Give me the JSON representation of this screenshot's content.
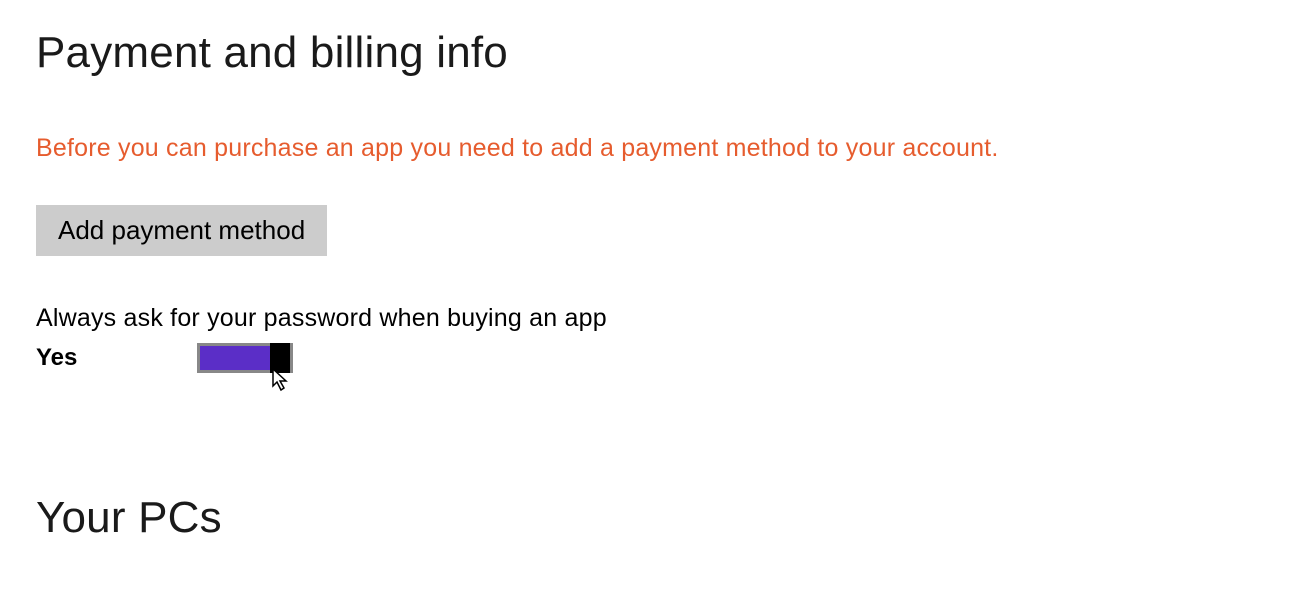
{
  "page": {
    "title": "Payment and billing info"
  },
  "warning": {
    "text": "Before you can purchase an app you need to add a payment method to your account."
  },
  "buttons": {
    "add_payment": "Add payment method"
  },
  "settings": {
    "password_prompt": {
      "label": "Always ask for your password when buying an app",
      "value": "Yes",
      "state": "on"
    }
  },
  "sections": {
    "pcs_title": "Your PCs"
  },
  "colors": {
    "warning": "#e65c2e",
    "toggle_on": "#5b2ec7",
    "button_bg": "#cccccc"
  }
}
